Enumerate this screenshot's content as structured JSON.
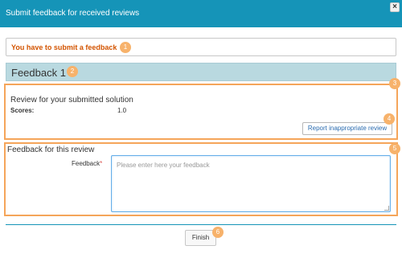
{
  "dialog": {
    "title": "Submit feedback for received reviews",
    "close_icon": "×"
  },
  "alert": {
    "text": "You have to submit a feedback",
    "color": "#d35400"
  },
  "feedback_header": {
    "title": "Feedback 1"
  },
  "review": {
    "title": "Review for your submitted solution",
    "scores_label": "Scores:",
    "scores_value": "1.0",
    "report_button": "Report inappropriate review"
  },
  "feedback_form": {
    "section_title": "Feedback for this review",
    "label": "Feedback",
    "required_mark": "*",
    "placeholder": "Please enter here your feedback",
    "value": ""
  },
  "footer": {
    "finish_button": "Finish"
  },
  "markers": [
    "1",
    "2",
    "3",
    "4",
    "5",
    "6"
  ],
  "colors": {
    "title_bar": "#1594b8",
    "panel_highlight": "#f5a55a",
    "marker": "#f7b26b",
    "header_bg": "#b9d9e0"
  }
}
